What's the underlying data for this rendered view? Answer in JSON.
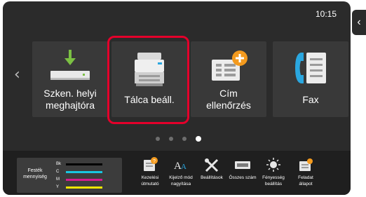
{
  "status": {
    "time": "10:15"
  },
  "tiles": [
    {
      "id": "scan",
      "label_line1": "Szken. helyi",
      "label_line2": "meghajtóra"
    },
    {
      "id": "tray",
      "label_line1": "Tálca beáll.",
      "label_line2": ""
    },
    {
      "id": "address",
      "label_line1": "Cím",
      "label_line2": "ellenőrzés"
    },
    {
      "id": "fax",
      "label_line1": "Fax",
      "label_line2": ""
    }
  ],
  "pagination": {
    "pages": 4,
    "active": 4
  },
  "toner": {
    "label_line1": "Festék",
    "label_line2": "mennyiség",
    "levels": [
      {
        "name": "Bk",
        "color": "#000000"
      },
      {
        "name": "C",
        "color": "#19c6e0"
      },
      {
        "name": "M",
        "color": "#d81b8f"
      },
      {
        "name": "Y",
        "color": "#f2e600"
      }
    ]
  },
  "bottom_items": [
    {
      "icon": "book-icon",
      "line1": "Kezelési",
      "line2": "útmutató"
    },
    {
      "icon": "text-size-icon",
      "line1": "Kijelző mód",
      "line2": "nagyítása"
    },
    {
      "icon": "tools-icon",
      "line1": "Beállítások",
      "line2": ""
    },
    {
      "icon": "counter-icon",
      "line1": "Összes szám",
      "line2": ""
    },
    {
      "icon": "brightness-icon",
      "line1": "Fényesség",
      "line2": "beállítás"
    },
    {
      "icon": "job-status-icon",
      "line1": "Feladat",
      "line2": "állapot"
    }
  ],
  "colors": {
    "accent_red": "#e4002b",
    "icon_blue": "#2aa7e0",
    "icon_orange": "#f39a1e",
    "icon_green": "#7bc043"
  }
}
